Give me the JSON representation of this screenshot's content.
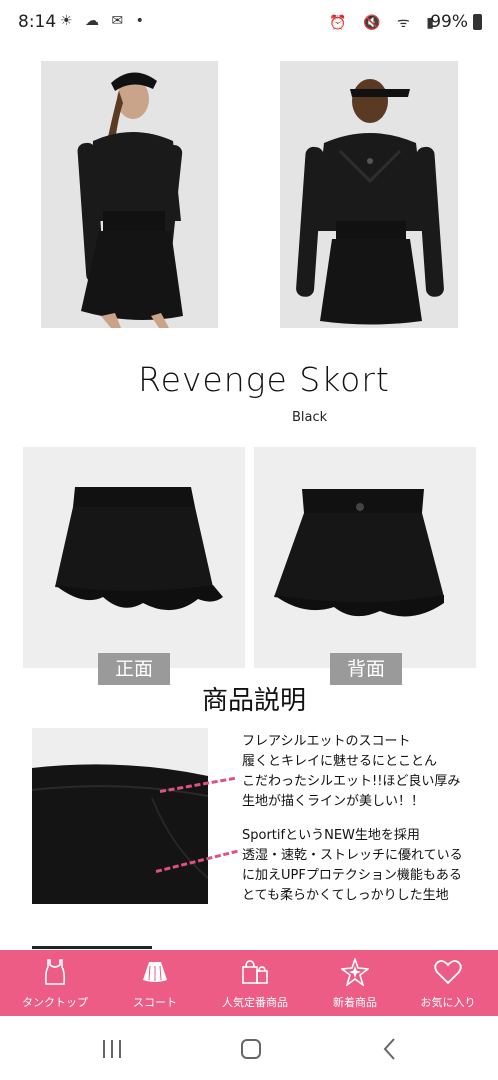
{
  "status_bar": {
    "time": "8:14",
    "left_icons": [
      "weather-icon",
      "cloud-icon",
      "mail-icon",
      "dot-icon"
    ],
    "right_icons": [
      "alarm-icon",
      "mute-icon",
      "wifi-icon",
      "signal-icon"
    ],
    "battery": "99%"
  },
  "product": {
    "name": "Revenge Skort",
    "color": "Black"
  },
  "views": {
    "front": "正面",
    "back": "背面"
  },
  "section_title": "商品説明",
  "description": {
    "paragraph1": [
      "フレアシルエットのスコート",
      "履くとキレイに魅せるにとことん",
      "こだわったシルエット!!ほど良い厚み",
      "生地が描くラインが美しい！！"
    ],
    "paragraph2": [
      "SportifというNEW生地を採用",
      "透湿・速乾・ストレッチに優れている",
      "に加えUPFプロテクション機能もある",
      "とても柔らかくてしっかりした生地"
    ]
  },
  "bottom_nav": {
    "items": [
      {
        "label": "タンクトップ",
        "icon": "tank-top-icon"
      },
      {
        "label": "スコート",
        "icon": "skirt-icon"
      },
      {
        "label": "人気定番商品",
        "icon": "shopping-bag-icon"
      },
      {
        "label": "新着商品",
        "icon": "sparkle-star-icon"
      },
      {
        "label": "お気に入り",
        "icon": "heart-icon"
      }
    ]
  },
  "colors": {
    "accent": "#ec5c85",
    "label_bg": "#9a9a9a"
  }
}
